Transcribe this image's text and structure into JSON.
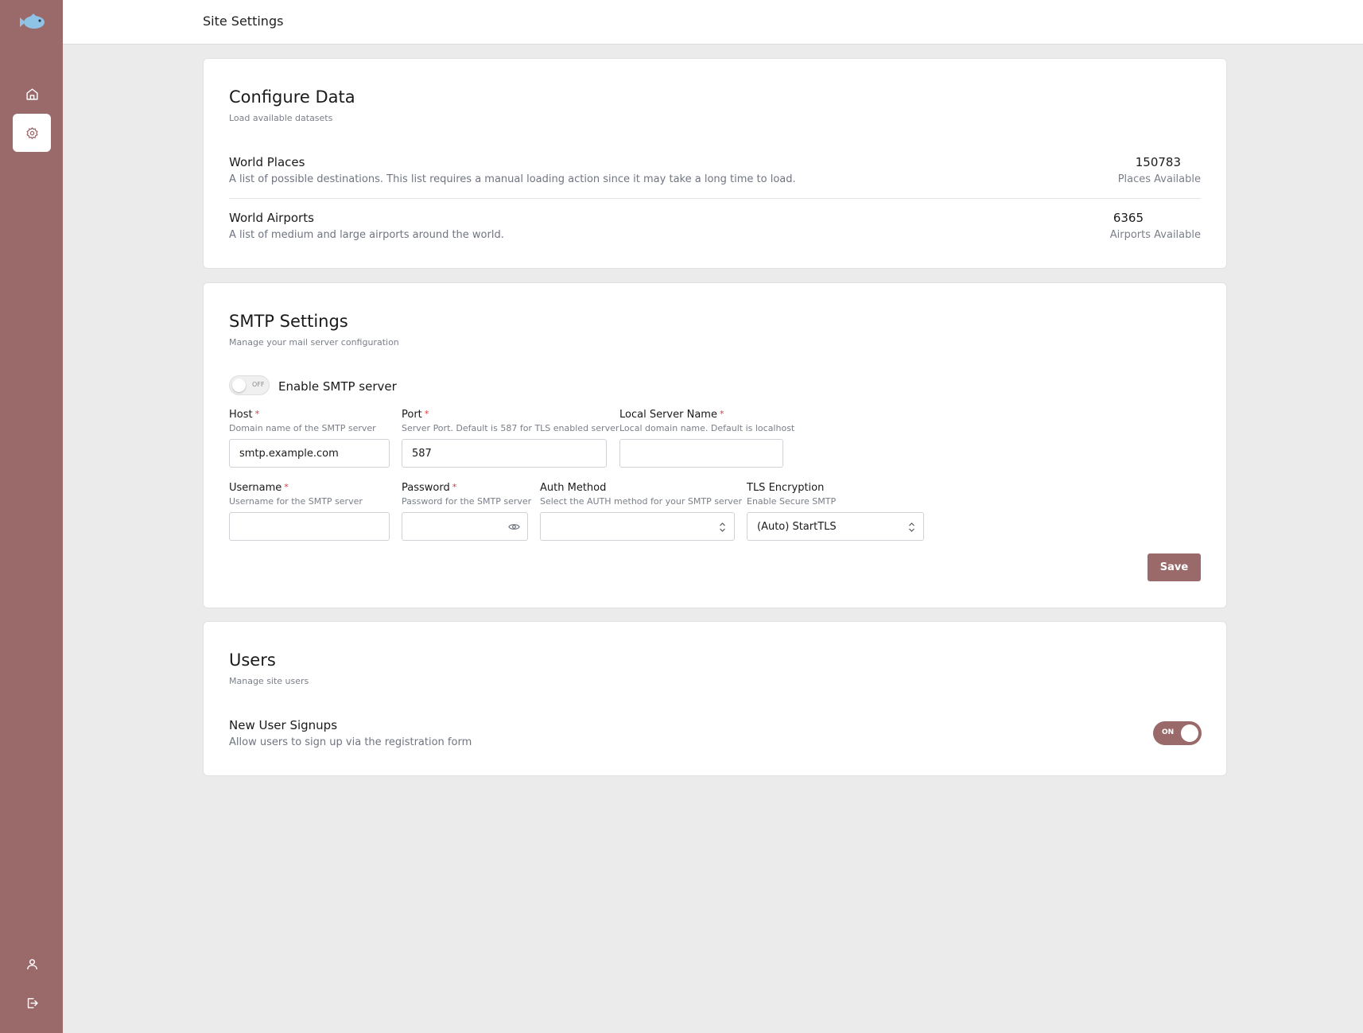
{
  "header": {
    "title": "Site Settings"
  },
  "sidebar": {
    "items": [
      {
        "name": "home",
        "icon": "home-icon"
      },
      {
        "name": "settings",
        "icon": "gear-icon",
        "active": true
      },
      {
        "name": "profile",
        "icon": "user-icon"
      },
      {
        "name": "logout",
        "icon": "logout-icon"
      }
    ]
  },
  "colors": {
    "accent": "#9a6a6b",
    "required": "#d53b3b",
    "logo": "#8fc3e6"
  },
  "configure": {
    "title": "Configure Data",
    "subtitle": "Load available datasets",
    "datasets": [
      {
        "name": "World Places",
        "description": "A list of possible destinations. This list requires a manual loading action since it may take a long time to load.",
        "count": "150783",
        "count_label": "Places Available"
      },
      {
        "name": "World Airports",
        "description": "A list of medium and large airports around the world.",
        "count": "6365",
        "count_label": "Airports Available"
      }
    ]
  },
  "smtp": {
    "title": "SMTP Settings",
    "subtitle": "Manage your mail server configuration",
    "enable_toggle": {
      "label": "Enable SMTP server",
      "state": "OFF"
    },
    "host": {
      "label": "Host",
      "help": "Domain name of the SMTP server",
      "value": "smtp.example.com",
      "required": "*"
    },
    "port": {
      "label": "Port",
      "help": "Server Port. Default is 587 for TLS enabled server",
      "value": "587",
      "required": "*"
    },
    "local_server": {
      "label": "Local Server Name",
      "help": "Local domain name. Default is localhost",
      "value": "",
      "required": "*"
    },
    "username": {
      "label": "Username",
      "help": "Username for the SMTP server",
      "value": "",
      "required": "*"
    },
    "password": {
      "label": "Password",
      "help": "Password for the SMTP server",
      "value": "",
      "required": "*"
    },
    "auth_method": {
      "label": "Auth Method",
      "help": "Select the AUTH method for your SMTP server",
      "value": ""
    },
    "tls": {
      "label": "TLS Encryption",
      "help": "Enable Secure SMTP",
      "value": "(Auto) StartTLS"
    },
    "save_label": "Save"
  },
  "users": {
    "title": "Users",
    "subtitle": "Manage site users",
    "signups": {
      "label": "New User Signups",
      "description": "Allow users to sign up via the registration form",
      "state": "ON"
    }
  }
}
